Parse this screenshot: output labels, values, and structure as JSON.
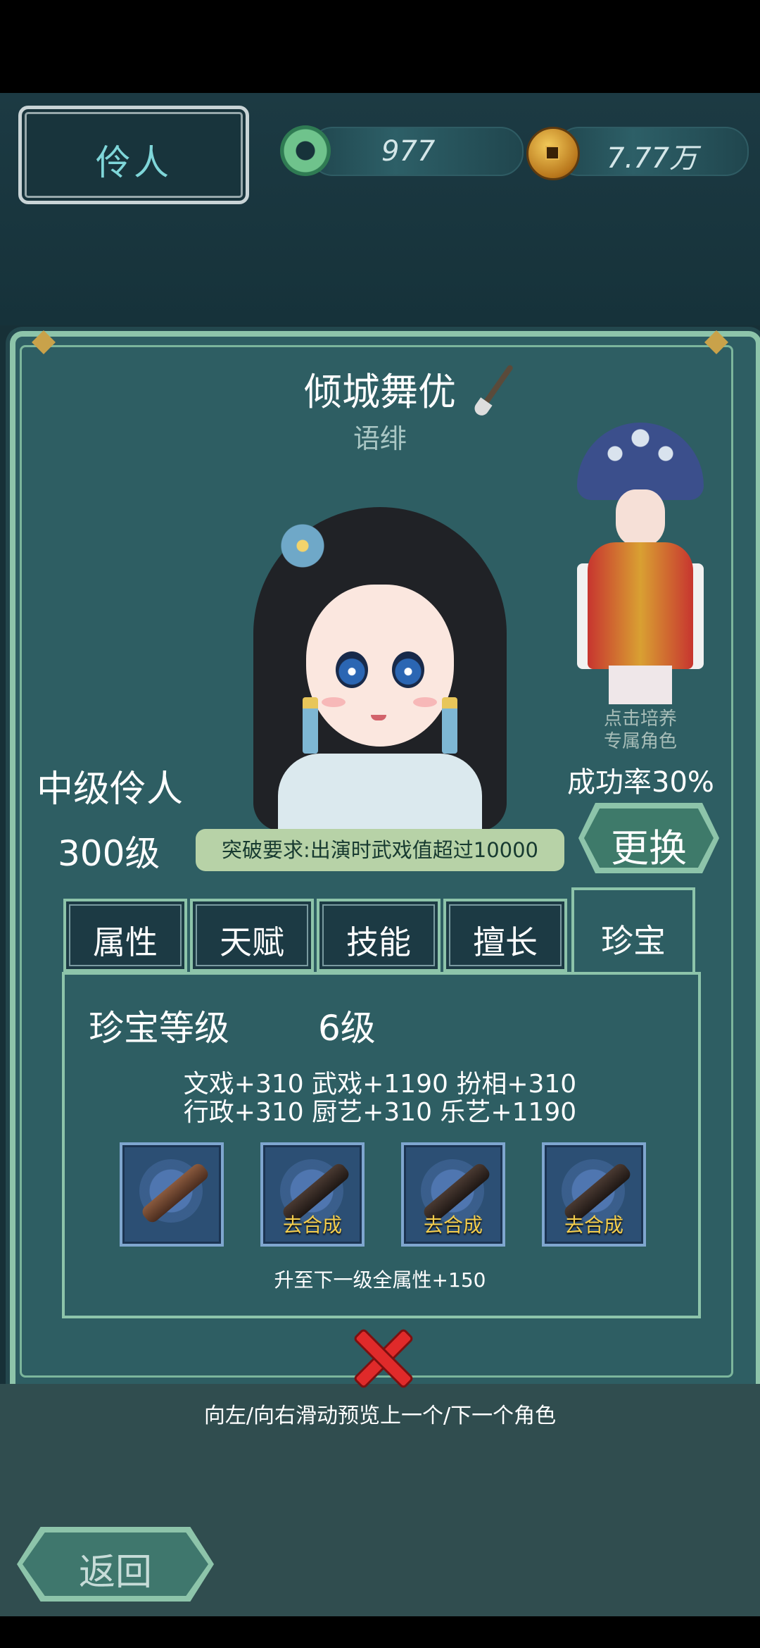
{
  "header": {
    "title": "伶人",
    "jade_value": "977",
    "coin_value": "7.77万"
  },
  "character": {
    "name": "倾城舞优",
    "title": "语绯",
    "rank": "中级伶人",
    "level": "300级",
    "breakthrough": "突破要求:出演时武戏值超过10000"
  },
  "side_role": {
    "cultivate_line1": "点击培养",
    "cultivate_line2": "专属角色",
    "success_rate": "成功率30%",
    "swap_label": "更换"
  },
  "tabs": [
    {
      "label": "属性",
      "active": false
    },
    {
      "label": "天赋",
      "active": false
    },
    {
      "label": "技能",
      "active": false
    },
    {
      "label": "擅长",
      "active": false
    },
    {
      "label": "珍宝",
      "active": true
    }
  ],
  "treasure": {
    "label": "珍宝等级",
    "level": "6级",
    "attrs_line1": "文戏+310 武戏+1190 扮相+310",
    "attrs_line2": "行政+310 厨艺+310 乐艺+1190",
    "slots": [
      {
        "label": ""
      },
      {
        "label": "去合成"
      },
      {
        "label": "去合成"
      },
      {
        "label": "去合成"
      }
    ],
    "next_bonus": "升至下一级全属性+150"
  },
  "footer": {
    "swipe_hint": "向左/向右滑动预览上一个/下一个角色",
    "back_label": "返回"
  },
  "colors": {
    "background": "#173037",
    "card": "#2e5e63",
    "frame": "#8dc4aa",
    "breakthrough_pill": "#b7d2a7",
    "synthesize_text": "#f3cd4d",
    "close_red": "#e02a2a"
  }
}
